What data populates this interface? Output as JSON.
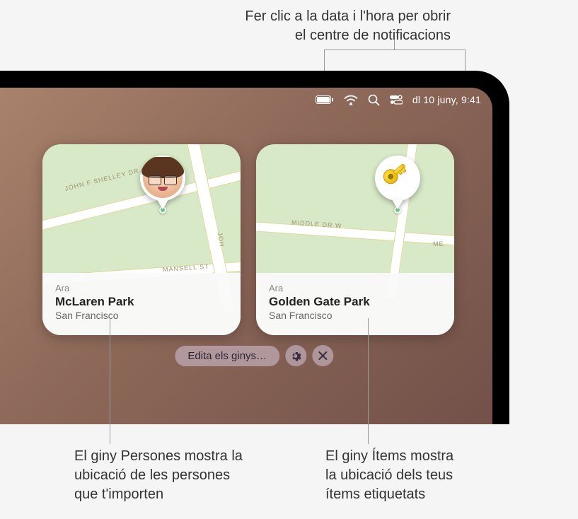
{
  "callouts": {
    "top_line1": "Fer clic a la data i l'hora per obrir",
    "top_line2": "el centre de notificacions",
    "bottom_left_line1": "El giny Persones mostra la",
    "bottom_left_line2": "ubicació de les persones",
    "bottom_left_line3": "que t'importen",
    "bottom_right_line1": "El giny Ítems mostra",
    "bottom_right_line2": "la ubicació dels teus",
    "bottom_right_line3": "ítems etiquetats"
  },
  "menubar": {
    "datetime": "dl 10 juny, 9:41",
    "icons": {
      "battery": "battery-icon",
      "wifi": "wifi-icon",
      "search": "search-icon",
      "control_center": "control-center-icon"
    }
  },
  "widgets": {
    "people": {
      "time_label": "Ara",
      "title": "McLaren Park",
      "subtitle": "San Francisco",
      "roads": {
        "road1": "JOHN F SHELLEY DR",
        "road2": "MANSELL ST",
        "road3": "JOH"
      },
      "pin_type": "person-avatar"
    },
    "items": {
      "time_label": "Ara",
      "title": "Golden Gate Park",
      "subtitle": "San Francisco",
      "roads": {
        "road1": "MIDDLE DR W",
        "road2": "ME"
      },
      "pin_type": "key"
    }
  },
  "edit_bar": {
    "label": "Edita els ginys…"
  }
}
